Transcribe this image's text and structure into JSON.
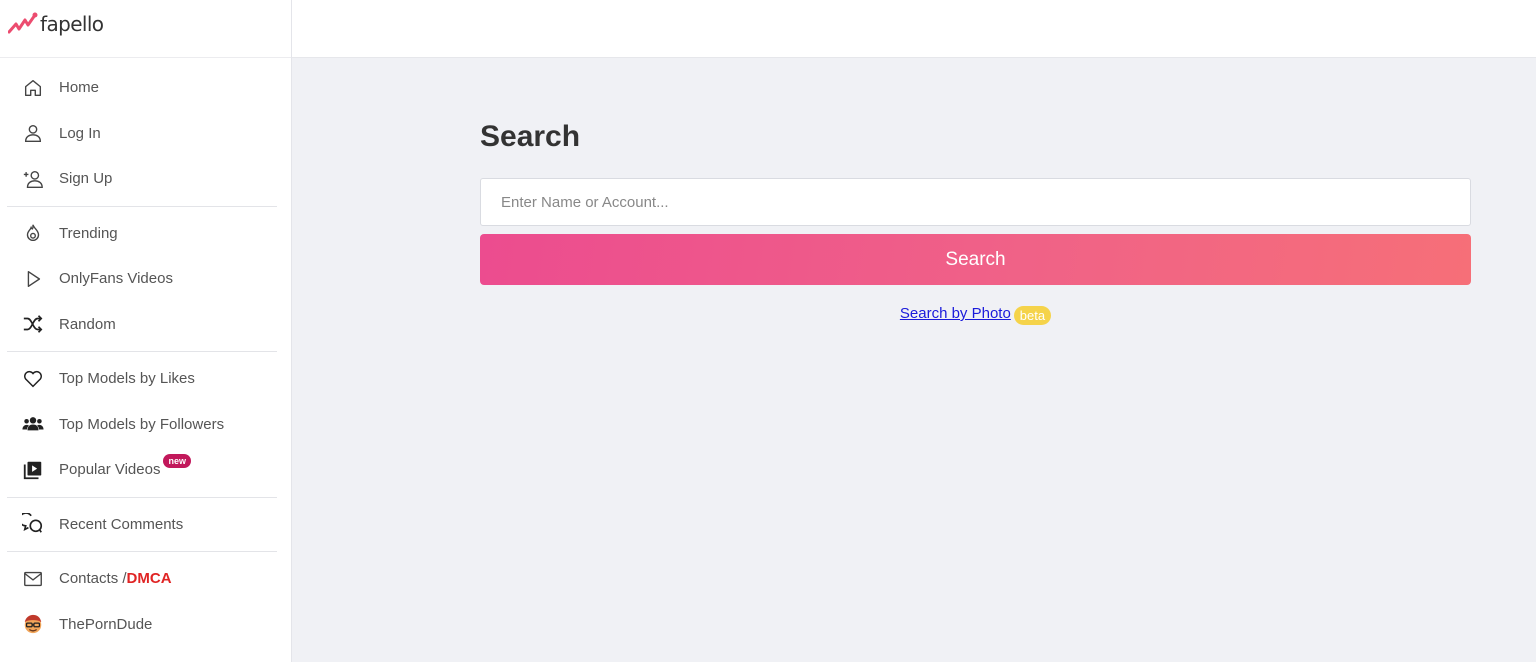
{
  "logo": {
    "text": "fapello"
  },
  "sidebar": {
    "groups": [
      [
        {
          "label": "Home",
          "icon": "home-icon"
        },
        {
          "label": "Log In",
          "icon": "user-icon"
        },
        {
          "label": "Sign Up",
          "icon": "user-plus-icon"
        }
      ],
      [
        {
          "label": "Trending",
          "icon": "flame-icon"
        },
        {
          "label": "OnlyFans Videos",
          "icon": "play-icon"
        },
        {
          "label": "Random",
          "icon": "shuffle-icon"
        }
      ],
      [
        {
          "label": "Top Models by Likes",
          "icon": "heart-icon"
        },
        {
          "label": "Top Models by Followers",
          "icon": "users-icon"
        },
        {
          "label": "Popular Videos",
          "icon": "video-library-icon",
          "badge": "new"
        }
      ],
      [
        {
          "label": "Recent Comments",
          "icon": "comments-icon"
        }
      ],
      [
        {
          "label": "Contacts / ",
          "label_highlight": "DMCA",
          "icon": "mail-icon"
        },
        {
          "label": "ThePornDude",
          "icon": "dude-avatar-icon"
        }
      ]
    ]
  },
  "main": {
    "title": "Search",
    "search": {
      "placeholder": "Enter Name or Account...",
      "value": ""
    },
    "search_button": "Search",
    "photo_link": "Search by Photo",
    "photo_badge": "beta"
  },
  "colors": {
    "accent_start": "#ec4c8f",
    "accent_end": "#f66f78",
    "dmca": "#e02424",
    "beta_badge": "#f5d34a",
    "new_badge": "#c2185b"
  }
}
